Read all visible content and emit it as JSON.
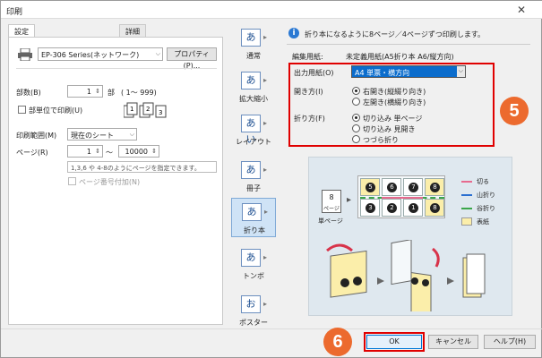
{
  "window": {
    "title": "印刷",
    "close": "✕"
  },
  "tabs": [
    {
      "label": "設定"
    },
    {
      "label": "詳細"
    }
  ],
  "left": {
    "printer": "EP-306 Series(ネットワーク)",
    "properties_button": "プロパティ(P)...",
    "copies_label": "部数(B)",
    "copies_value": "1",
    "copies_unit": "部",
    "copies_range": "( 1～ 999)",
    "collate_label": "部単位で印刷(U)",
    "range_label": "印刷範囲(M)",
    "range_value": "現在のシート",
    "pages_label": "ページ(R)",
    "pages_from": "1",
    "pages_sep": "～",
    "pages_to": "10000",
    "pages_hint": "1,3,6 や 4-8のようにページを指定できます。",
    "page_number_label": "ページ番号付加(N)"
  },
  "modes": [
    {
      "glyph": "あ",
      "label": "通常"
    },
    {
      "glyph": "あ",
      "label": "拡大縮小"
    },
    {
      "glyph": "あい",
      "label": "レイアウト"
    },
    {
      "glyph": "あ",
      "label": "冊子"
    },
    {
      "glyph": "あ",
      "label": "折り本"
    },
    {
      "glyph": "あ",
      "label": "トンボ"
    },
    {
      "glyph": "お",
      "label": "ポスター"
    }
  ],
  "right": {
    "info": "折り本になるように8ページ／4ページずつ印刷します。",
    "paper_label": "編集用紙:",
    "paper_value": "未定義用紙(A5折り本 A6/縦方向)",
    "output_label": "出力用紙(O)",
    "output_value": "A4 単票・横方向",
    "open_label": "開き方(I)",
    "open_right": "右開き(縦綴り向き)",
    "open_left": "左開き(横綴り向き)",
    "fold_label": "折り方(F)",
    "fold_single": "切り込み 単ページ",
    "fold_spread": "切り込み 見開き",
    "fold_accordion": "つづら折り",
    "diagram": {
      "single_page": "8",
      "single_page_sub": "ページ",
      "single_caption": "単ページ",
      "top_row": [
        "5",
        "6",
        "7",
        "8"
      ],
      "bottom_row": [
        "3",
        "2",
        "1",
        "8"
      ],
      "legend": [
        "切る",
        "山折り",
        "谷折り",
        "表紙"
      ],
      "colors": {
        "cut": "#e76a8e",
        "mountain": "#2a6fd0",
        "valley": "#3aa64a",
        "cover": "#fbeeaa"
      }
    }
  },
  "callouts": {
    "five": "5",
    "six": "6"
  },
  "footer": {
    "ok": "OK",
    "cancel": "キャンセル",
    "help": "ヘルプ(H)"
  }
}
